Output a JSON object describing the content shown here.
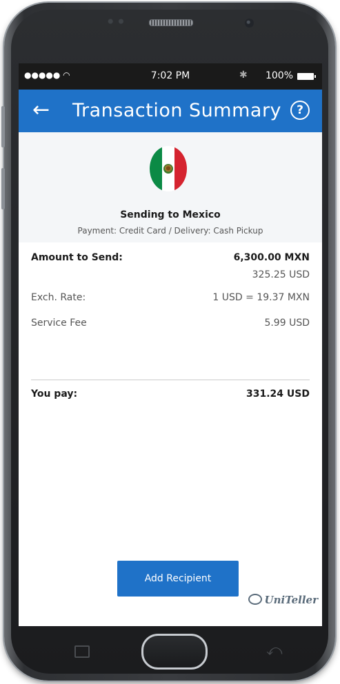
{
  "status_bar": {
    "signal": "●●●●● ",
    "wifi_icon": "wifi-icon",
    "time": "7:02 PM",
    "bluetooth_icon": "bluetooth-icon",
    "battery_percent": "100%"
  },
  "app_bar": {
    "back_glyph": "←",
    "title": "Transaction Summary",
    "help_glyph": "?",
    "color": "#1f72c8"
  },
  "header": {
    "sending_to": "Sending to Mexico",
    "payment_line": "Payment: Credit Card / Delivery: Cash Pickup"
  },
  "rows": {
    "amount_label": "Amount to Send:",
    "amount_value": "6,300.00 MXN",
    "amount_usd": "325.25 USD",
    "rate_label": "Exch. Rate:",
    "rate_value": "1 USD = 19.37 MXN",
    "fee_label": "Service Fee",
    "fee_value": "5.99 USD"
  },
  "total": {
    "label": "You pay:",
    "value": "331.24 USD"
  },
  "actions": {
    "add_recipient_label": "Add Recipient"
  },
  "brand": {
    "logo_text": "UniTeller"
  }
}
